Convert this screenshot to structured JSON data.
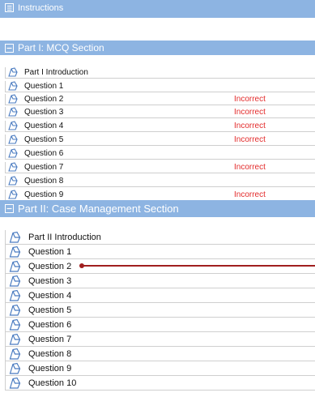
{
  "instructions": {
    "label": "Instructions",
    "icon": "checklist-icon"
  },
  "part1": {
    "title": "Part I: MCQ Section",
    "toggle_icon": "collapse-icon",
    "intro": "Part I Introduction",
    "questions": [
      {
        "label": "Question 1",
        "status": ""
      },
      {
        "label": "Question 2",
        "status": "Incorrect"
      },
      {
        "label": "Question 3",
        "status": "Incorrect"
      },
      {
        "label": "Question 4",
        "status": "Incorrect"
      },
      {
        "label": "Question 5",
        "status": "Incorrect"
      },
      {
        "label": "Question 6",
        "status": ""
      },
      {
        "label": "Question 7",
        "status": "Incorrect"
      },
      {
        "label": "Question 8",
        "status": ""
      },
      {
        "label": "Question 9",
        "status": "Incorrect"
      }
    ]
  },
  "part2": {
    "title": "Part II: Case Management Section",
    "toggle_icon": "collapse-icon",
    "intro": "Part II Introduction",
    "questions": [
      {
        "label": "Question 1"
      },
      {
        "label": "Question 2"
      },
      {
        "label": "Question 3"
      },
      {
        "label": "Question 4"
      },
      {
        "label": "Question 5"
      },
      {
        "label": "Question 6"
      },
      {
        "label": "Question 7"
      },
      {
        "label": "Question 8"
      },
      {
        "label": "Question 9"
      },
      {
        "label": "Question 10"
      }
    ]
  },
  "colors": {
    "header_bar": "#8db4e2",
    "incorrect": "#e32b2b",
    "annotation_pointer": "#a01e1e"
  }
}
